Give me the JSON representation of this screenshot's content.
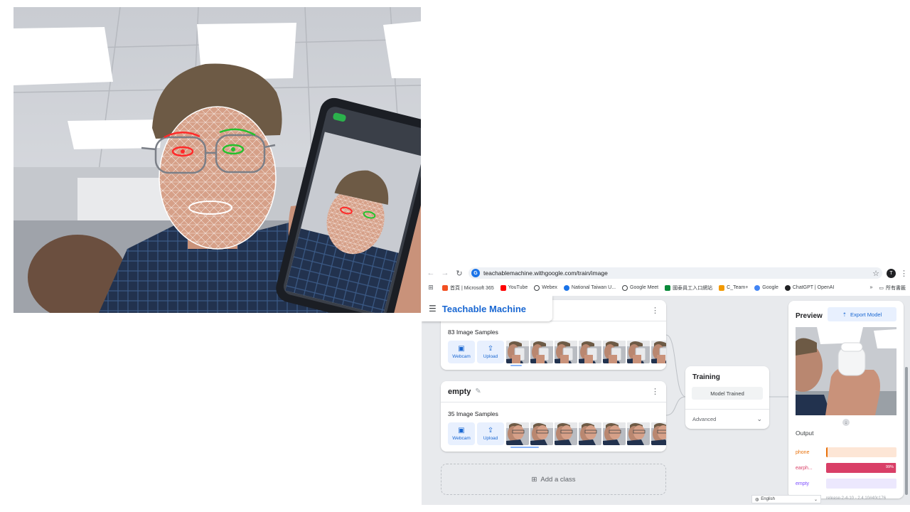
{
  "browser": {
    "url": "teachablemachine.withgoogle.com/train/image",
    "profile_initial": "T",
    "bookmarks": [
      {
        "label": "首頁 | Microsoft 365",
        "color": "#f25022"
      },
      {
        "label": "YouTube",
        "color": "#ff0000"
      },
      {
        "label": "Webex",
        "color": "#3c4043"
      },
      {
        "label": "National Taiwan U...",
        "color": "#1a73e8"
      },
      {
        "label": "Google Meet",
        "color": "#3c4043"
      },
      {
        "label": "國泰員工入口網站",
        "color": "#0a8a3a"
      },
      {
        "label": "C_Team+",
        "color": "#f29900"
      },
      {
        "label": "Google",
        "color": "#4285f4"
      },
      {
        "label": "ChatGPT | OpenAI",
        "color": "#202124"
      }
    ],
    "bookmarks_more": "»",
    "all_bookmarks": "所有書籤"
  },
  "app": {
    "title": "Teachable Machine",
    "classes": [
      {
        "name": "",
        "samples": "83 Image Samples",
        "webcam": "Webcam",
        "upload": "Upload",
        "thumb_kind": "phone"
      },
      {
        "name": "empty",
        "samples": "35 Image Samples",
        "webcam": "Webcam",
        "upload": "Upload",
        "thumb_kind": "face"
      }
    ],
    "add_class": "Add a class",
    "training": {
      "title": "Training",
      "button": "Model Trained",
      "advanced": "Advanced"
    },
    "preview": {
      "title": "Preview",
      "export": "Export Model",
      "output_title": "Output",
      "outputs": [
        {
          "label": "phone",
          "value": 0.01,
          "pct_text": "",
          "color": "#e8710a",
          "bg": "#fde6d6"
        },
        {
          "label": "earph...",
          "value": 0.99,
          "pct_text": "99%",
          "color": "#d93f67",
          "bg": "#f8d5df"
        },
        {
          "label": "empty",
          "value": 0.0,
          "pct_text": "",
          "color": "#7c4dff",
          "bg": "#ece8fd"
        }
      ]
    },
    "language": "English",
    "release": "release-2-4-10 - 2.4.10#40c176"
  },
  "colors": {
    "brand_blue": "#1967d2",
    "app_bg": "#e8eaed"
  }
}
